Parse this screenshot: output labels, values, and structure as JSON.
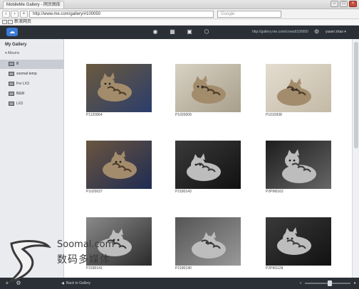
{
  "browser": {
    "title_tab": "MobileMe Gallery - 网页图库",
    "url": "http://www.me.com/gallery/#100050",
    "search_placeholder": "Google",
    "bookmark_label": "新浪网页"
  },
  "app": {
    "gallery_url": "http://gallery.me.com/crowd/100050",
    "user": "yuwei zhao ▾"
  },
  "sidebar": {
    "title": "My Gallery",
    "section": "▾ Albums",
    "albums": [
      {
        "label": "lll",
        "selected": true
      },
      {
        "label": "soomal temp"
      },
      {
        "label": "For LX3"
      },
      {
        "label": "B&W"
      },
      {
        "label": "LX3"
      }
    ]
  },
  "photos": [
    {
      "caption": "P1120864",
      "tone": "color"
    },
    {
      "caption": "P1020009",
      "tone": "color"
    },
    {
      "caption": "P1010938",
      "tone": "color"
    },
    {
      "caption": "P1020037",
      "tone": "color"
    },
    {
      "caption": "P2180143",
      "tone": "bw"
    },
    {
      "caption": "P2PM0162",
      "tone": "bw"
    },
    {
      "caption": "P2180141",
      "tone": "bw"
    },
    {
      "caption": "P2180140",
      "tone": "bw"
    },
    {
      "caption": "P2PM1128",
      "tone": "bw"
    }
  ],
  "bottom": {
    "back_label": "Back to Gallery",
    "zoom_level": 0.55
  },
  "watermark": {
    "line1": "Soomal.com",
    "line2": "数码多媒体"
  }
}
